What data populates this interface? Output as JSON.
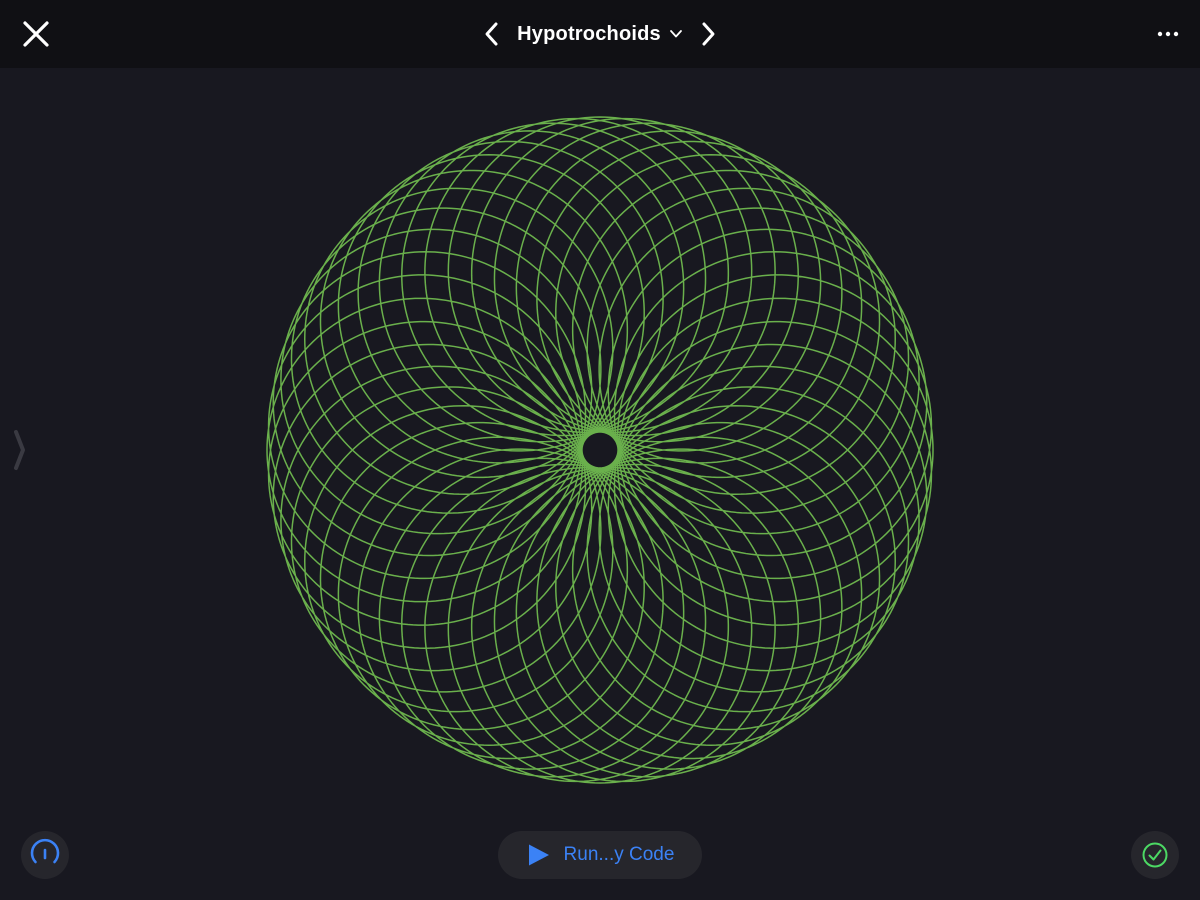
{
  "header": {
    "title": "Hypotrochoids",
    "close_icon": "close-icon",
    "prev_icon": "chevron-left-icon",
    "next_icon": "chevron-right-icon",
    "dropdown_icon": "chevron-down-icon",
    "more_icon": "ellipsis-icon"
  },
  "bottom_bar": {
    "run_label": "Run...y Code",
    "run_icon": "play-icon",
    "speed_icon": "speedometer-icon",
    "status_icon": "checkmark-circle-icon"
  },
  "colors": {
    "background": "#181820",
    "topbar": "#101014",
    "curve": "#6ab04c",
    "accent": "#3b82f6",
    "status_ok": "#4cd964"
  }
}
